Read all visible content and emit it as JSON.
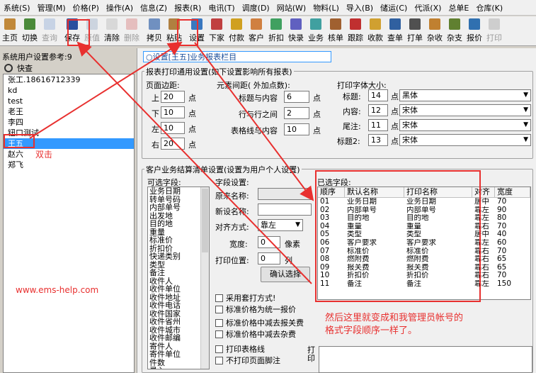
{
  "menu": [
    "系统(S)",
    "管理(M)",
    "价格(P)",
    "操作(A)",
    "信息(Z)",
    "报表(R)",
    "电讯(T)",
    "调度(D)",
    "网站(W)",
    "物料(L)",
    "导入(B)",
    "储运(C)",
    "代派(X)",
    "总单E",
    "仓库(K)"
  ],
  "toolbar": [
    {
      "label": "主页",
      "icon": "home-icon",
      "color": "#c0883a",
      "enabled": true
    },
    {
      "label": "切换",
      "icon": "switch-icon",
      "color": "#4a8a3a",
      "enabled": true
    },
    {
      "label": "查询",
      "icon": "query-icon",
      "color": "#7b9fd0",
      "enabled": false
    },
    {
      "label": "保存",
      "icon": "save-icon",
      "color": "#2a4f9e",
      "enabled": true
    },
    {
      "label": "原值",
      "icon": "restore-icon",
      "color": "#8aa0c0",
      "enabled": false
    },
    {
      "label": "清除",
      "icon": "clear-icon",
      "color": "#d8d8d8",
      "enabled": true
    },
    {
      "label": "删除",
      "icon": "delete-icon",
      "color": "#d06060",
      "enabled": false
    },
    {
      "label": "拷贝",
      "icon": "copy-icon",
      "color": "#7090c0",
      "enabled": true
    },
    {
      "label": "粘贴",
      "icon": "paste-icon",
      "color": "#b08040",
      "enabled": true
    },
    {
      "label": "设置",
      "icon": "settings-icon",
      "color": "#3a78c0",
      "enabled": true
    },
    {
      "label": "下家",
      "icon": "next-party-icon",
      "color": "#c04040",
      "enabled": true
    },
    {
      "label": "付款",
      "icon": "payment-icon",
      "color": "#d0a020",
      "enabled": true
    },
    {
      "label": "客户",
      "icon": "customer-icon",
      "color": "#d08040",
      "enabled": true
    },
    {
      "label": "折扣",
      "icon": "discount-icon",
      "color": "#40a060",
      "enabled": true
    },
    {
      "label": "快录",
      "icon": "quick-entry-icon",
      "color": "#6060c0",
      "enabled": true
    },
    {
      "label": "业务",
      "icon": "business-icon",
      "color": "#40a0a0",
      "enabled": true
    },
    {
      "label": "核单",
      "icon": "verify-icon",
      "color": "#a06030",
      "enabled": true
    },
    {
      "label": "跟踪",
      "icon": "track-icon",
      "color": "#c03030",
      "enabled": true
    },
    {
      "label": "收款",
      "icon": "receipt-icon",
      "color": "#d0a030",
      "enabled": true
    },
    {
      "label": "查单",
      "icon": "search-order-icon",
      "color": "#3060a0",
      "enabled": true
    },
    {
      "label": "打单",
      "icon": "print-order-icon",
      "color": "#505050",
      "enabled": true
    },
    {
      "label": "杂收",
      "icon": "misc-income-icon",
      "color": "#c08030",
      "enabled": true
    },
    {
      "label": "杂支",
      "icon": "misc-expense-icon",
      "color": "#608030",
      "enabled": true
    },
    {
      "label": "报价",
      "icon": "quote-icon",
      "color": "#3070b0",
      "enabled": true
    },
    {
      "label": "打印",
      "icon": "print-icon",
      "color": "#909090",
      "enabled": false
    }
  ],
  "left": {
    "title": "系统用户设置参考:9",
    "search_label": "快查",
    "users": [
      "张工.18616712339",
      "kd",
      "test",
      "老王",
      "李四",
      "钮口测试",
      "王五",
      "赵六",
      "郑飞"
    ],
    "selected_index": 6
  },
  "right": {
    "tab_title": "○设置[王五]业务报表栏目",
    "print_group": {
      "title": "报表打印通用设置(如下设置影响所有报表)",
      "margin_title": "页面边距:",
      "margins": [
        {
          "label": "上",
          "value": "20",
          "unit": "点"
        },
        {
          "label": "下",
          "value": "10",
          "unit": "点"
        },
        {
          "label": "左",
          "value": "10",
          "unit": "点"
        },
        {
          "label": "右",
          "value": "20",
          "unit": "点"
        }
      ],
      "spacing_title": "元素间距( 外加点数):",
      "spacings": [
        {
          "label": "标题与内容",
          "value": "6",
          "unit": "点"
        },
        {
          "label": "行与行之间",
          "value": "2",
          "unit": "点"
        },
        {
          "label": "表格线与内容",
          "value": "10",
          "unit": "点"
        }
      ],
      "font_title": "打印字体大小:",
      "fonts": [
        {
          "label": "标题:",
          "size": "14",
          "unit": "点",
          "face": "黑体"
        },
        {
          "label": "内容:",
          "size": "12",
          "unit": "点",
          "face": "宋体"
        },
        {
          "label": "尾注:",
          "size": "11",
          "unit": "点",
          "face": "宋体"
        },
        {
          "label": "标题2:",
          "size": "13",
          "unit": "点",
          "face": "宋体"
        }
      ]
    },
    "settle_group": {
      "title": "客户业务结算清单设置(设置为用户个人设置)",
      "available_title": "可选字段:",
      "available": [
        "业务日期",
        "转单号码",
        "内部单号",
        "出发地",
        "目的地",
        "重量",
        "标准价",
        "折扣价",
        "快递类别",
        "类型",
        "备注",
        "收件人",
        "收件单位",
        "收件地址",
        "收件电话",
        "收件国家",
        "收件省州",
        "收件城市",
        "收件邮编",
        "寄件人",
        "寄件单位",
        "件数",
        "录入"
      ],
      "field_title": "字段设置:",
      "orig_name_label": "原来名称:",
      "orig_name_value": "",
      "new_name_label": "新设名称:",
      "new_name_value": "",
      "align_label": "对齐方式:",
      "align_value": "靠左",
      "width_label": "宽度:",
      "width_value": "0",
      "width_unit": "像素",
      "pos_label": "打印位置:",
      "pos_value": "0",
      "pos_unit": "列",
      "confirm_button": "确认选择",
      "options": [
        "采用套打方式!",
        "标准价格为统一报价",
        "标准价格中减去报关费",
        "标准价格中减去杂费",
        "打印表格线",
        "不打印页面脚注"
      ],
      "print_label": "打印",
      "selected_title": "已选字段:",
      "columns": [
        "顺序",
        "默认名称",
        "打印名称",
        "对齐",
        "宽度"
      ],
      "rows": [
        [
          "01",
          "业务日期",
          "业务日期",
          "居中",
          "70"
        ],
        [
          "02",
          "内部单号",
          "内部单号",
          "靠左",
          "90"
        ],
        [
          "03",
          "目的地",
          "目的地",
          "靠左",
          "80"
        ],
        [
          "04",
          "重量",
          "重量",
          "靠右",
          "70"
        ],
        [
          "05",
          "类型",
          "类型",
          "居中",
          "40"
        ],
        [
          "06",
          "客户要求",
          "客户要求",
          "靠左",
          "60"
        ],
        [
          "07",
          "标准价",
          "标准价",
          "靠右",
          "70"
        ],
        [
          "08",
          "燃附费",
          "燃附费",
          "靠右",
          "65"
        ],
        [
          "09",
          "报关费",
          "报关费",
          "靠右",
          "65"
        ],
        [
          "10",
          "折扣价",
          "折扣价",
          "靠右",
          "70"
        ],
        [
          "11",
          "备注",
          "备注",
          "靠左",
          "150"
        ]
      ]
    }
  },
  "annotations": {
    "double_click": "双击",
    "website": "www.ems-help.com",
    "note_line1": "然后这里就变成和我管理员帐号的",
    "note_line2": "格式字段顺序一样了。"
  },
  "colors": {
    "annotation": "#e8302f",
    "selection": "#3399ff"
  }
}
